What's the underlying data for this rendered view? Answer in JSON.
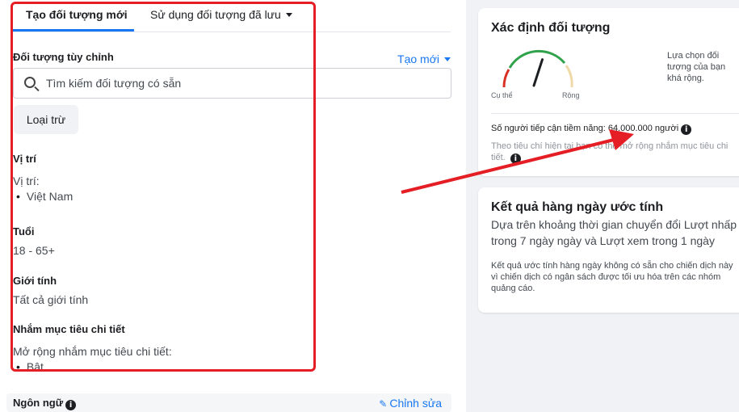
{
  "tabs": {
    "create_new": "Tạo đối tượng mới",
    "use_saved": "Sử dụng đối tượng đã lưu"
  },
  "custom_audience": {
    "title": "Đối tượng tùy chỉnh",
    "create_new": "Tạo mới",
    "search_placeholder": "Tìm kiếm đối tượng có sẵn",
    "exclude_button": "Loại trừ"
  },
  "location": {
    "title": "Vị trí",
    "label": "Vị trí:",
    "value": "Việt Nam"
  },
  "age": {
    "title": "Tuổi",
    "value": "18 - 65+"
  },
  "gender": {
    "title": "Giới tính",
    "value": "Tất cả giới tính"
  },
  "detailed_targeting": {
    "title": "Nhắm mục tiêu chi tiết",
    "label": "Mở rộng nhắm mục tiêu chi tiết:",
    "value": "Bật"
  },
  "language": {
    "title": "Ngôn ngữ",
    "edit": "Chỉnh sửa"
  },
  "audience_definition": {
    "title": "Xác định đối tượng",
    "gauge_left": "Cụ thể",
    "gauge_right": "Rộng",
    "gauge_level": 0.6,
    "description": "Lựa chọn đối tượng của bạn khá rộng.",
    "potential_reach": "Số người tiếp cận tiềm năng: 64.000.000 người",
    "note": "Theo tiêu chí hiện tại bạn có thể mở rộng nhắm mục tiêu chi tiết."
  },
  "daily_results": {
    "title": "Kết quả hàng ngày ước tính",
    "subtitle": "Dựa trên khoảng thời gian chuyển đổi Lượt nhấp trong 7 ngày ngày và Lượt xem trong 1 ngày",
    "note": "Kết quả ước tính hàng ngày không có sẵn cho chiến dịch này vì chiến dịch có ngân sách được tối ưu hóa trên các nhóm quảng cáo."
  },
  "colors": {
    "accent": "#1877f2",
    "highlight": "#e41e24",
    "gauge_red": "#d93025",
    "gauge_green": "#31a24c",
    "gauge_tan": "#f0d9a8"
  }
}
